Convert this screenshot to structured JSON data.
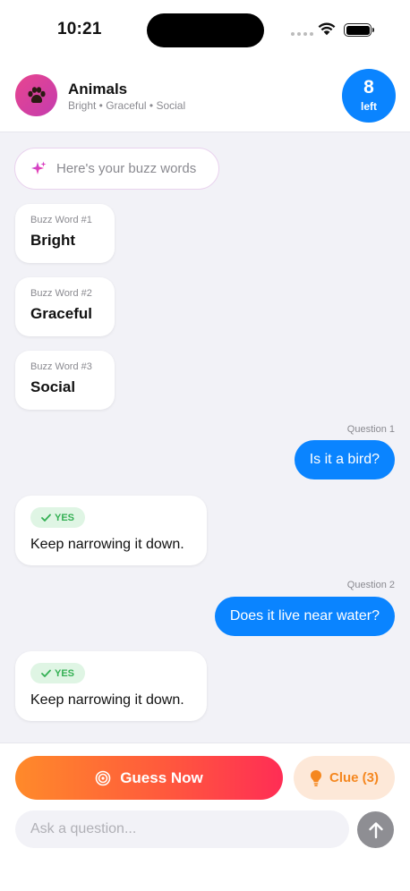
{
  "status_bar": {
    "time": "10:21"
  },
  "header": {
    "title": "Animals",
    "subtitle": "Bright • Graceful • Social",
    "count": "8",
    "count_label": "left",
    "avatar_icon": "paw-icon"
  },
  "intro": {
    "text": "Here's your buzz words",
    "icon": "sparkle-icon"
  },
  "buzz_words": [
    {
      "caption": "Buzz Word #1",
      "word": "Bright"
    },
    {
      "caption": "Buzz Word #2",
      "word": "Graceful"
    },
    {
      "caption": "Buzz Word #3",
      "word": "Social"
    }
  ],
  "messages": [
    {
      "label": "Question 1",
      "question": "Is it a bird?",
      "answer_tag": "YES",
      "answer": "Keep narrowing it down."
    },
    {
      "label": "Question 2",
      "question": "Does it live near water?",
      "answer_tag": "YES",
      "answer": "Keep narrowing it down."
    }
  ],
  "actions": {
    "guess_label": "Guess Now",
    "clue_label": "Clue (3)",
    "ask_placeholder": "Ask a question..."
  },
  "colors": {
    "accent_blue": "#0a84ff",
    "chat_background": "#f2f2f7",
    "yes_green": "#34b054",
    "clue_orange": "#f5871f"
  }
}
